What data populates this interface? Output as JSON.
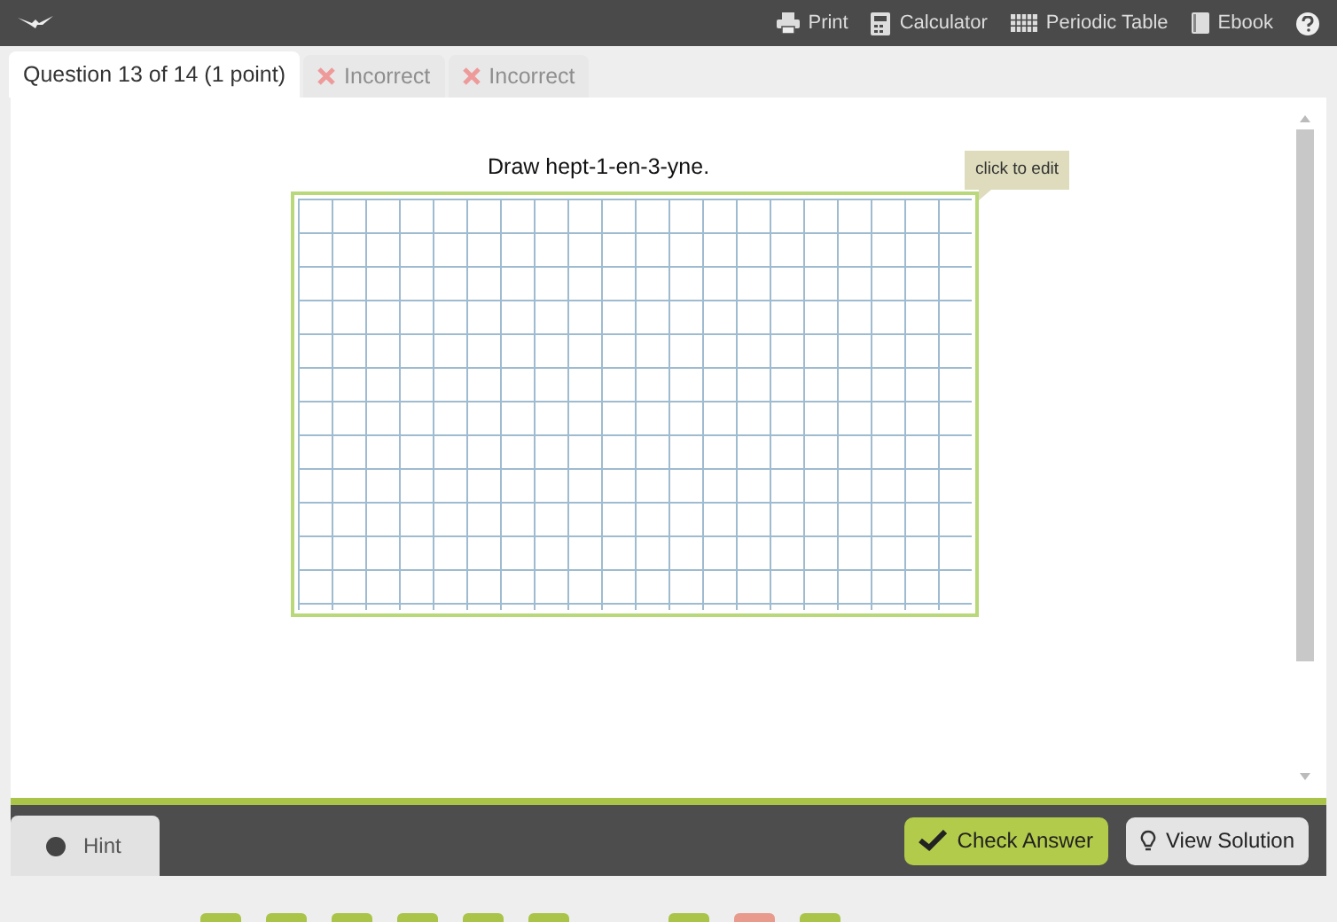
{
  "toolbar": {
    "items": [
      {
        "label": "Print",
        "kind": "print"
      },
      {
        "label": "Calculator",
        "kind": "calculator"
      },
      {
        "label": "Periodic Table",
        "kind": "table"
      },
      {
        "label": "Ebook",
        "kind": "book"
      }
    ]
  },
  "tabs": [
    {
      "label": "Question 13 of 14 (1 point)",
      "selected": true,
      "kind": "question"
    },
    {
      "label": "Incorrect",
      "selected": false,
      "kind": "incorrect"
    },
    {
      "label": "Incorrect",
      "selected": false,
      "kind": "incorrect"
    }
  ],
  "question": {
    "prompt": "Draw hept-1-en-3-yne.",
    "tooltip": "click to edit"
  },
  "footer": {
    "hint": "Hint",
    "check": "Check Answer",
    "solution": "View Solution"
  },
  "navigator": [
    {
      "color": "#a9c449"
    },
    {
      "color": "#a9c449"
    },
    {
      "color": "#a9c449"
    },
    {
      "color": "#a9c449"
    },
    {
      "color": "#a9c449"
    },
    {
      "color": "#a9c449"
    },
    {
      "kind": "gap"
    },
    {
      "color": "#a9c449"
    },
    {
      "color": "#e89a8c"
    },
    {
      "color": "#a9c449"
    }
  ]
}
